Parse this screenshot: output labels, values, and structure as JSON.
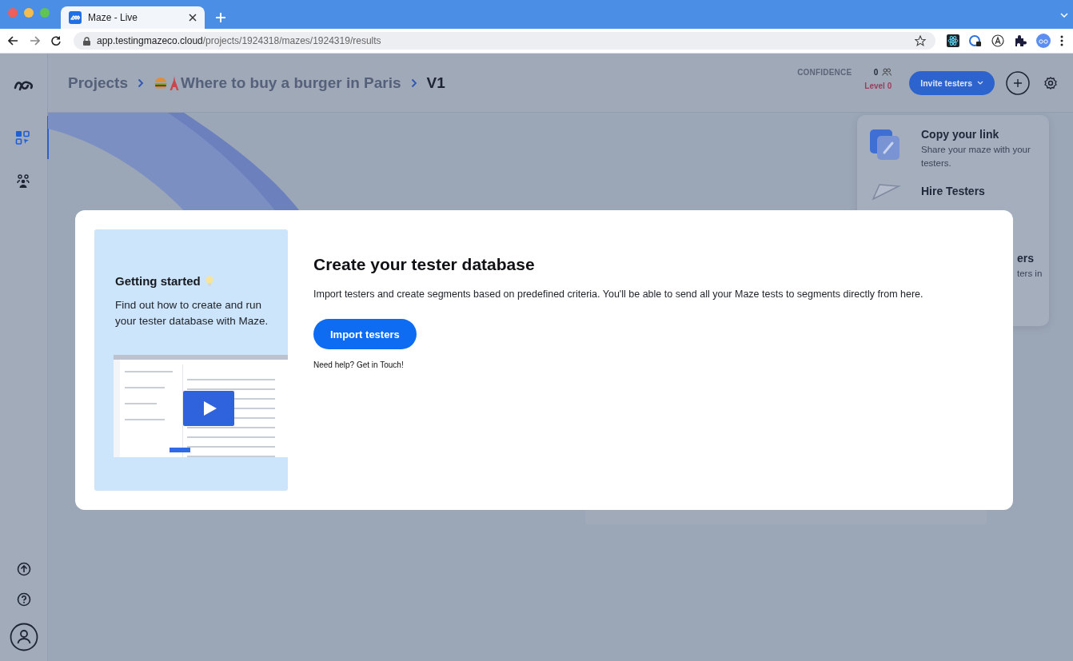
{
  "browser": {
    "tab": {
      "title": "Maze - Live"
    },
    "url": {
      "host": "app.testingmazeco.cloud",
      "path": "/projects/1924318/mazes/1924319/results"
    }
  },
  "header": {
    "breadcrumbs": [
      {
        "text": "Projects",
        "current": false,
        "kind": "plain"
      },
      {
        "text": "Where to buy a burger in Paris",
        "current": false,
        "kind": "emoji"
      },
      {
        "text": "V1",
        "current": true,
        "kind": "plain"
      }
    ],
    "confidence": {
      "label": "CONFIDENCE",
      "count": "0",
      "level": "Level 0"
    },
    "invite_button": "Invite testers"
  },
  "sidebar": {
    "items": [
      {
        "kind": "mazes",
        "selected": true
      },
      {
        "kind": "testers",
        "selected": false
      }
    ],
    "bottom": [
      {
        "kind": "upload"
      },
      {
        "kind": "help"
      },
      {
        "kind": "profile"
      }
    ]
  },
  "invite_panel": {
    "items": [
      {
        "kind": "link",
        "title": "Copy your link",
        "description": "Share your maze with your testers."
      },
      {
        "kind": "hire",
        "title": "Hire Testers"
      },
      {
        "kind": "cut",
        "title": "ers",
        "description": "ters in"
      }
    ]
  },
  "modal": {
    "side": {
      "title": "Getting started",
      "text": "Find out how to create and run your tester database with Maze."
    },
    "title": "Create your tester database",
    "text": "Import testers and create segments based on predefined criteria. You'll be able to send all your Maze tests to segments directly from here.",
    "button": "Import testers",
    "help": "Need help? Get in Touch!"
  }
}
